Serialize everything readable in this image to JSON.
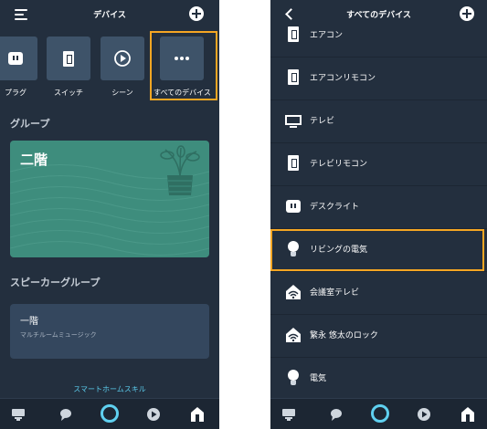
{
  "left_screen": {
    "header": {
      "title": "デバイス"
    },
    "categories": [
      {
        "label": "プラグ",
        "icon": "plug-icon"
      },
      {
        "label": "スイッチ",
        "icon": "switch-icon"
      },
      {
        "label": "シーン",
        "icon": "scene-play-icon"
      },
      {
        "label": "すべてのデバイス",
        "icon": "more-dots-icon",
        "highlighted": true
      }
    ],
    "groups_section_title": "グループ",
    "group_card": {
      "name": "二階"
    },
    "speaker_section_title": "スピーカーグループ",
    "speaker_card": {
      "name": "一階",
      "subtitle": "マルチルームミュージック"
    },
    "smart_home_skill_link": "スマートホームスキル"
  },
  "right_screen": {
    "header": {
      "title": "すべてのデバイス"
    },
    "devices": [
      {
        "label": "エアコン",
        "icon": "switch-icon"
      },
      {
        "label": "エアコンリモコン",
        "icon": "switch-icon"
      },
      {
        "label": "テレビ",
        "icon": "tv-icon"
      },
      {
        "label": "テレビリモコン",
        "icon": "switch-icon"
      },
      {
        "label": "デスクライト",
        "icon": "plug-icon"
      },
      {
        "label": "リビングの電気",
        "icon": "bulb-icon",
        "highlighted": true
      },
      {
        "label": "会議室テレビ",
        "icon": "wifi-home-icon"
      },
      {
        "label": "繁永 悠太のロック",
        "icon": "wifi-home-icon"
      },
      {
        "label": "電気",
        "icon": "bulb-icon"
      }
    ]
  },
  "bottom_nav": [
    "home-icon",
    "chat-icon",
    "alexa-icon",
    "play-icon",
    "devices-icon"
  ],
  "colors": {
    "background": "#232f3e",
    "tile": "#3e5369",
    "group_card": "#3e8d7d",
    "highlight": "#f5a623",
    "alexa": "#5fd0f0",
    "link": "#5ac8e8"
  }
}
